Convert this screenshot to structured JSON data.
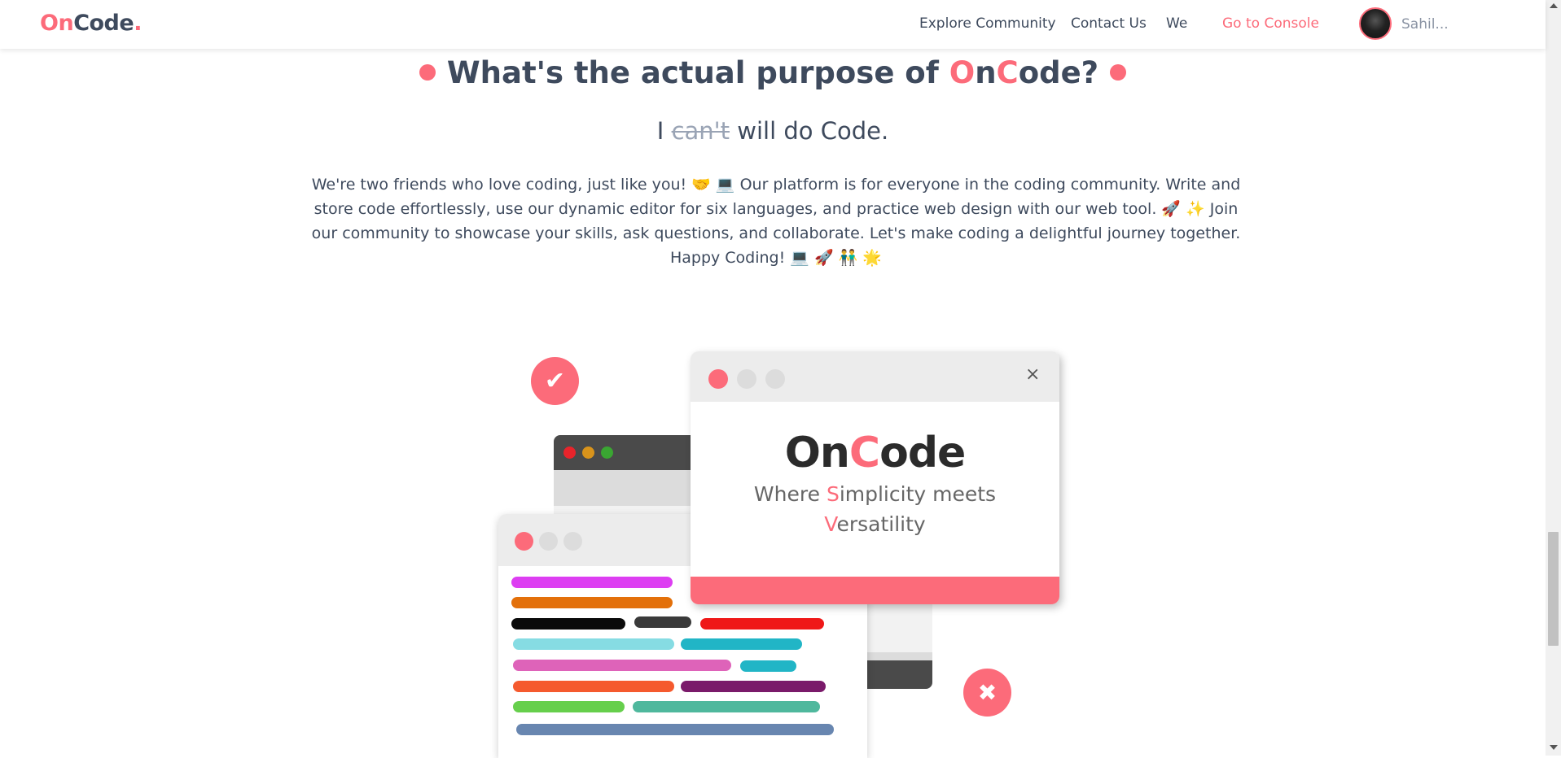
{
  "header": {
    "logo_main": "OnCode",
    "logo_on": "On",
    "logo_code": "Code",
    "logo_dot": ".",
    "nav": {
      "explore": "Explore Community",
      "contact": "Contact Us",
      "we": "We",
      "console": "Go to Console"
    },
    "user_name": "Sahil..."
  },
  "section": {
    "title_prefix": "What's the actual purpose of ",
    "title_o": "O",
    "title_n": "n",
    "title_c": "C",
    "title_suffix": "ode?",
    "subtitle_i": "I",
    "subtitle_strike": "can't",
    "subtitle_rest": "will do Code.",
    "paragraph": "We're two friends who love coding, just like you! 🤝 💻 Our platform is for everyone in the coding community. Write and store code effortlessly, use our dynamic editor for six languages, and practice web design with our web tool. 🚀 ✨ Join our community to showcase your skills, ask questions, and collaborate. Let's make coding a delightful journey together. Happy Coding! 💻 🚀 👬 🌟"
  },
  "illustration": {
    "brand_on": "On",
    "brand_c": "C",
    "brand_ode": "ode",
    "tag_where": "Where ",
    "tag_s": "S",
    "tag_implicity": "implicity meets",
    "tag_v": "V",
    "tag_ersatility": "ersatility",
    "close_glyph": "×",
    "check_glyph": "✔",
    "cross_glyph": "✖"
  },
  "colors": {
    "accent": "#fc6b7a",
    "text": "#3e4a5d"
  }
}
